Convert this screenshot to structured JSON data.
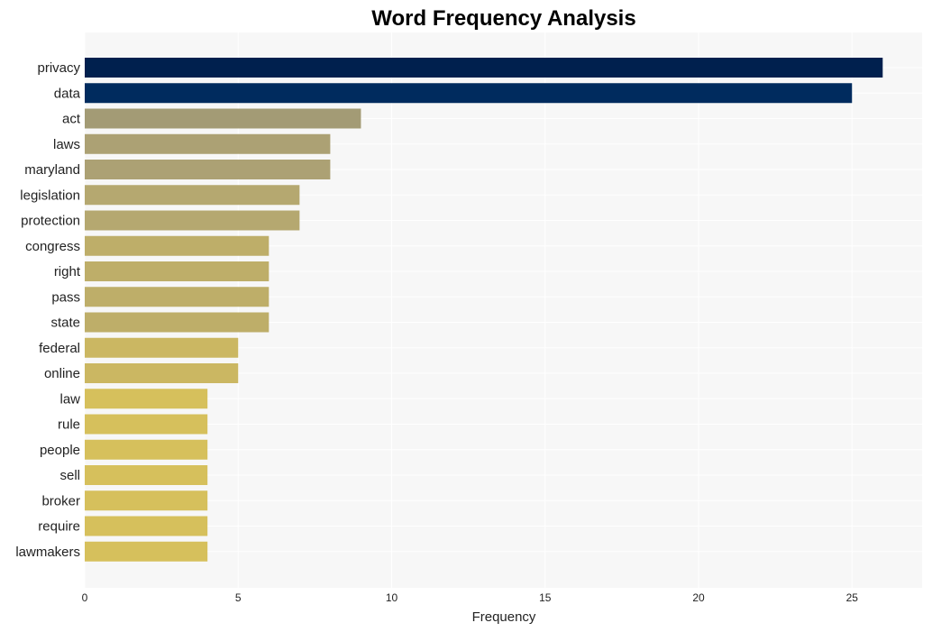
{
  "chart_data": {
    "type": "bar",
    "orientation": "horizontal",
    "title": "Word Frequency Analysis",
    "xlabel": "Frequency",
    "ylabel": "",
    "xlim": [
      0,
      27.3
    ],
    "xticks": [
      0,
      5,
      10,
      15,
      20,
      25
    ],
    "grid": true,
    "categories": [
      "privacy",
      "data",
      "act",
      "laws",
      "maryland",
      "legislation",
      "protection",
      "congress",
      "right",
      "pass",
      "state",
      "federal",
      "online",
      "law",
      "rule",
      "people",
      "sell",
      "broker",
      "require",
      "lawmakers"
    ],
    "values": [
      26,
      25,
      9,
      8,
      8,
      7,
      7,
      6,
      6,
      6,
      6,
      5,
      5,
      4,
      4,
      4,
      4,
      4,
      4,
      4
    ],
    "colors": [
      "#00204e",
      "#002b5e",
      "#a39b75",
      "#aca174",
      "#aca174",
      "#b5a870",
      "#b5a870",
      "#beae69",
      "#beae69",
      "#beae69",
      "#beae69",
      "#cbb762",
      "#cbb762",
      "#d6c05c",
      "#d6c05c",
      "#d6c05c",
      "#d6c05c",
      "#d6c05c",
      "#d6c05c",
      "#d6c05c"
    ]
  }
}
